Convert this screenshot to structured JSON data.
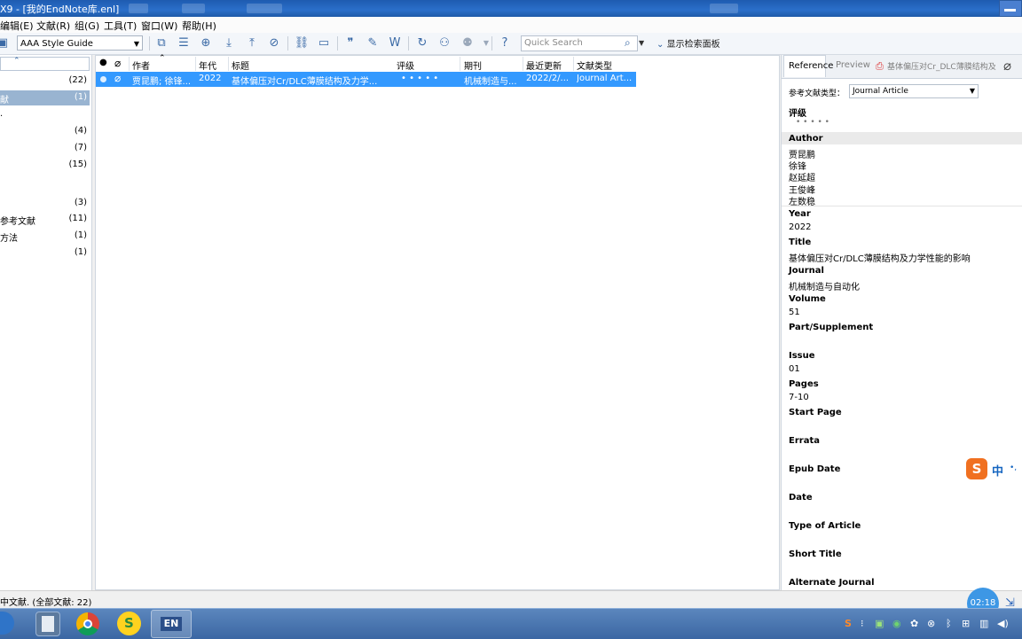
{
  "window": {
    "title": "X9 - [我的EndNote库.enl]"
  },
  "menu": [
    "编辑(E)",
    "文献(R)",
    "组(G)",
    "工具(T)",
    "窗口(W)",
    "帮助(H)"
  ],
  "toolbar": {
    "style": "AAA Style Guide",
    "search_placeholder": "Quick Search",
    "show_panel": "显示检索面板"
  },
  "groups": [
    {
      "name": "",
      "count": "(22)"
    },
    {
      "name": "献",
      "count": "(1)",
      "selected": true
    },
    {
      "name": ".",
      "count": ""
    },
    {
      "name": "",
      "count": "(4)"
    },
    {
      "name": "",
      "count": "(7)"
    },
    {
      "name": "",
      "count": "(15)"
    },
    {
      "name": "",
      "count": "(3)"
    },
    {
      "name": "参考文献",
      "count": "(11)"
    },
    {
      "name": "方法",
      "count": "(1)"
    },
    {
      "name": "",
      "count": "(1)"
    }
  ],
  "list": {
    "columns": [
      "作者",
      "年代",
      "标题",
      "评级",
      "期刊",
      "最近更新",
      "文献类型"
    ],
    "rows": [
      {
        "author": "贾昆鹏; 徐锋...",
        "year": "2022",
        "title": "基体偏压对Cr/DLC薄膜结构及力学...",
        "rating": "• • • • •",
        "journal": "机械制造与...",
        "updated": "2022/2/...",
        "type": "Journal Art..."
      }
    ]
  },
  "right": {
    "tabs": [
      "Reference",
      "Preview",
      "基体偏压对Cr_DLC薄膜结构及"
    ],
    "reftype_label": "参考文献类型：",
    "reftype_value": "Journal Article",
    "rating_label": "评级",
    "rating_dots": "• • • • •",
    "author_label": "Author",
    "authors": [
      "贾昆鹏",
      "徐锋",
      "赵延超",
      "王俊峰",
      "左数稳"
    ],
    "fields": [
      {
        "label": "Year",
        "value": "2022"
      },
      {
        "label": "Title",
        "value": "基体偏压对Cr/DLC薄膜结构及力学性能的影响"
      },
      {
        "label": "Journal",
        "value": "机械制造与自动化"
      },
      {
        "label": "Volume",
        "value": "51"
      },
      {
        "label": "Part/Supplement",
        "value": ""
      },
      {
        "label": "Issue",
        "value": "01"
      },
      {
        "label": "Pages",
        "value": "7-10"
      },
      {
        "label": "Start Page",
        "value": ""
      },
      {
        "label": "Errata",
        "value": ""
      },
      {
        "label": "Epub Date",
        "value": ""
      },
      {
        "label": "Date",
        "value": ""
      },
      {
        "label": "Type of Article",
        "value": ""
      },
      {
        "label": "Short Title",
        "value": ""
      },
      {
        "label": "Alternate Journal",
        "value": ""
      }
    ]
  },
  "ime": {
    "logo": "S",
    "mode": "中"
  },
  "status": {
    "text": "中文献. (全部文献: 22)"
  },
  "timer": "02:18",
  "colors": {
    "selection": "#3399ff",
    "title_bar": "#2b6fca"
  }
}
